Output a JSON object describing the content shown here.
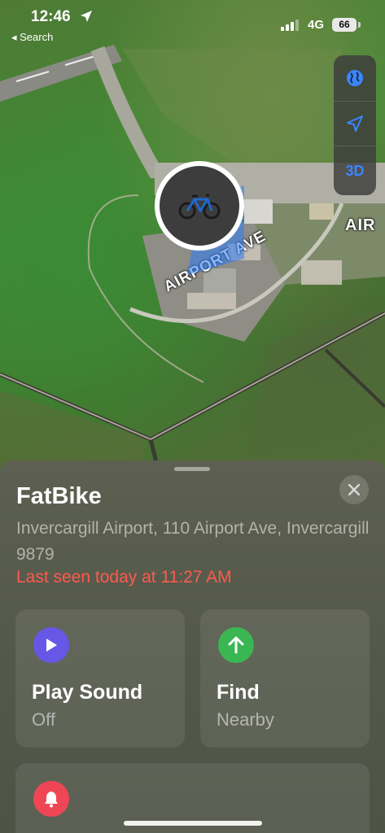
{
  "status_bar": {
    "time": "12:46",
    "back_label": "◂ Search",
    "network": "4G",
    "battery": "66"
  },
  "map": {
    "road_label": "AIRPORT AVE",
    "place_label": "AIR",
    "controls": {
      "globe_icon": "globe-icon",
      "locate_icon": "location-arrow-icon",
      "threed_label": "3D",
      "accent": "#3a86ff"
    },
    "pin_icon": "bicycle-icon"
  },
  "sheet": {
    "title": "FatBike",
    "address": "Invercargill Airport, 110 Airport Ave, Invercargill 9879",
    "last_seen": "Last seen today at 11:27 AM",
    "last_seen_color": "#ff5a4f",
    "close_icon": "close-icon",
    "actions": [
      {
        "label": "Play Sound",
        "sub": "Off",
        "icon": "play-icon",
        "color": "#6757e6"
      },
      {
        "label": "Find",
        "sub": "Nearby",
        "icon": "arrow-up-icon",
        "color": "#3ab652"
      }
    ],
    "notify": {
      "icon": "bell-icon",
      "color": "#ef4655"
    }
  }
}
